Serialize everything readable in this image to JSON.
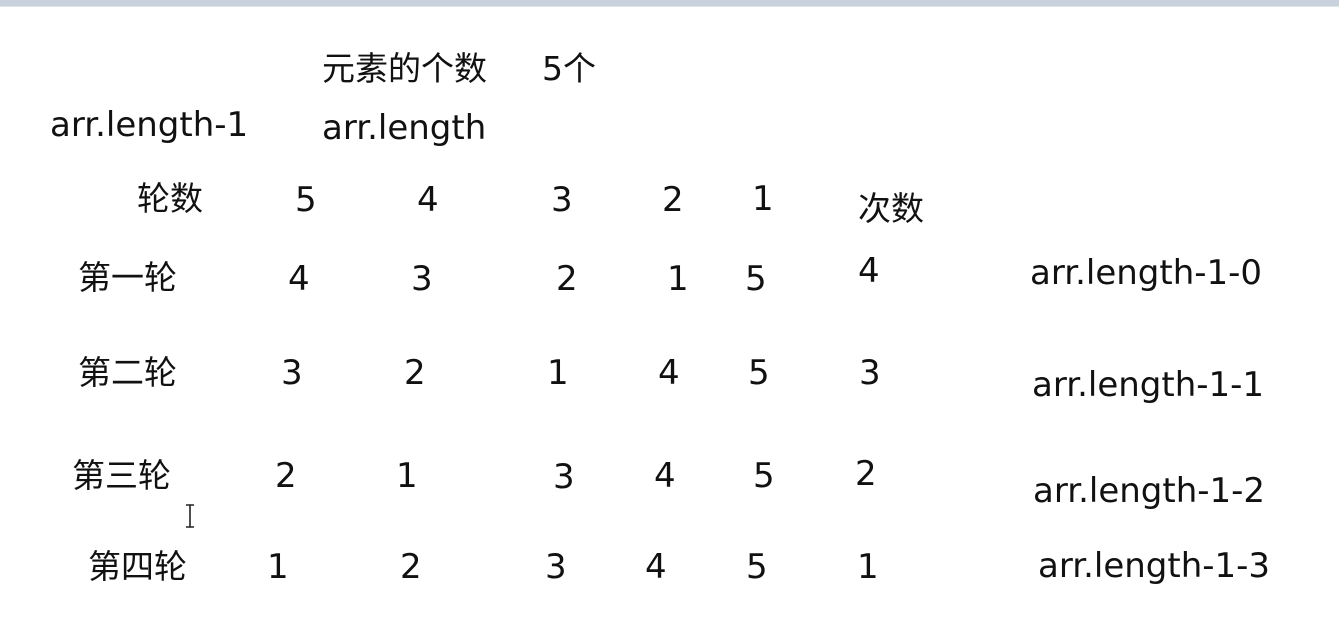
{
  "header": {
    "elements_label": "元素的个数",
    "elements_count": "5个",
    "length_minus_one": "arr.length-1",
    "length": "arr.length"
  },
  "table": {
    "rounds_label": "轮数",
    "times_label": "次数",
    "header_values": [
      "5",
      "4",
      "3",
      "2",
      "1"
    ],
    "rows": [
      {
        "label": "第一轮",
        "values": [
          "4",
          "3",
          "2",
          "1",
          "5"
        ],
        "times": "4",
        "formula": "arr.length-1-0"
      },
      {
        "label": "第二轮",
        "values": [
          "3",
          "2",
          "1",
          "4",
          "5"
        ],
        "times": "3",
        "formula": "arr.length-1-1"
      },
      {
        "label": "第三轮",
        "values": [
          "2",
          "1",
          "3",
          "4",
          "5"
        ],
        "times": "2",
        "formula": "arr.length-1-2"
      },
      {
        "label": "第四轮",
        "values": [
          "1",
          "2",
          "3",
          "4",
          "5"
        ],
        "times": "1",
        "formula": "arr.length-1-3"
      }
    ]
  },
  "icons": {
    "cursor": "text-cursor-icon"
  }
}
